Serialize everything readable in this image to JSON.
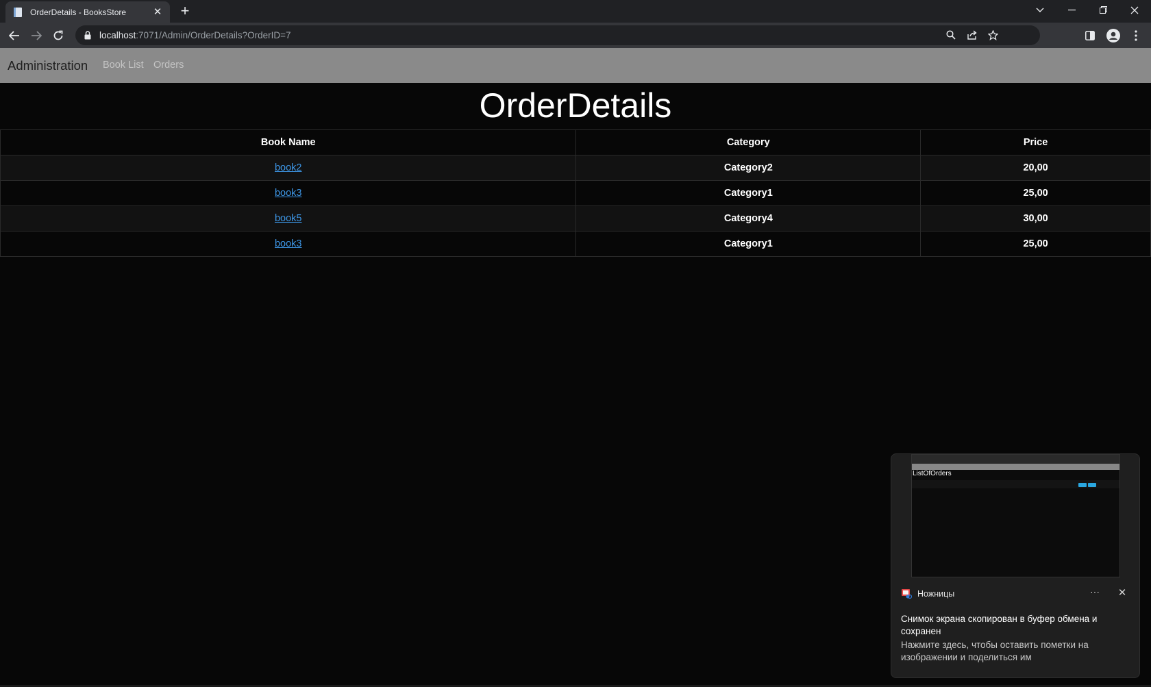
{
  "browser": {
    "tab_title": "OrderDetails - BooksStore",
    "url_host": "localhost",
    "url_rest": ":7071/Admin/OrderDetails?OrderID=7"
  },
  "navbar": {
    "brand": "Administration",
    "links": [
      "Book List",
      "Orders"
    ]
  },
  "page": {
    "title": "OrderDetails"
  },
  "table": {
    "headers": [
      "Book Name",
      "Category",
      "Price"
    ],
    "rows": [
      {
        "book": "book2",
        "category": "Category2",
        "price": "20,00"
      },
      {
        "book": "book3",
        "category": "Category1",
        "price": "25,00"
      },
      {
        "book": "book5",
        "category": "Category4",
        "price": "30,00"
      },
      {
        "book": "book3",
        "category": "Category1",
        "price": "25,00"
      }
    ]
  },
  "notification": {
    "thumbnail_title": "ListOfOrders",
    "app_name": "Ножницы",
    "title": "Снимок экрана скопирован в буфер обмена и сохранен",
    "body": "Нажмите здесь, чтобы оставить пометки на изображении и поделиться им",
    "more_label": "···",
    "close_label": "✕"
  },
  "colors": {
    "link": "#3d96e6",
    "navbar_bg": "#8a8a8a",
    "page_bg": "#070707"
  }
}
